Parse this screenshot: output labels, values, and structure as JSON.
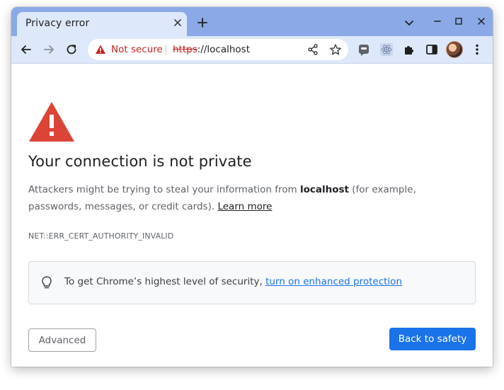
{
  "tab": {
    "title": "Privacy error"
  },
  "omnibox": {
    "security_label": "Not secure",
    "url_scheme": "https",
    "url_rest": "://localhost"
  },
  "page": {
    "heading": "Your connection is not private",
    "explain_part1": "Attackers might be trying to steal your information from ",
    "explain_host": "localhost",
    "explain_part2": " (for example, passwords, messages, or credit cards). ",
    "learn_more": "Learn more",
    "error_code": "NET::ERR_CERT_AUTHORITY_INVALID",
    "tip_text": "To get Chrome’s highest level of security, ",
    "tip_link": "turn on enhanced protection",
    "advanced_button": "Advanced",
    "back_button": "Back to safety"
  },
  "icons": {
    "tab_close": "close-icon",
    "new_tab": "plus-icon",
    "back": "arrow-left-icon",
    "forward": "arrow-right-icon",
    "reload": "reload-icon",
    "warning": "warning-triangle-icon",
    "share": "share-icon",
    "bookmark": "star-icon",
    "extensions": "puzzle-icon",
    "side_panel": "side-panel-icon",
    "menu": "kebab-menu-icon",
    "tip": "lightbulb-icon"
  },
  "colors": {
    "tabstrip": "#8aa9e6",
    "toolbar": "#dde8fb",
    "danger": "#c5221f",
    "warning_icon": "#db4437",
    "accent": "#1a73e8"
  }
}
